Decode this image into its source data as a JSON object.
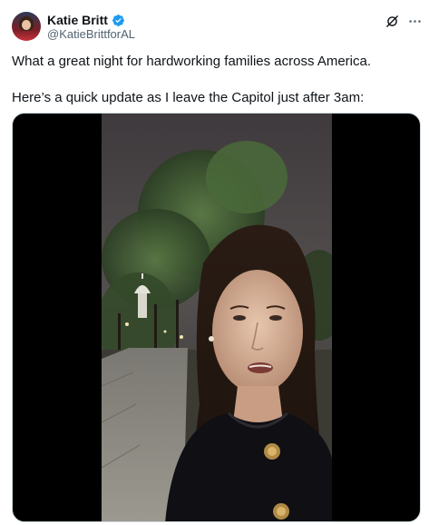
{
  "author": {
    "display_name": "Katie Britt",
    "handle": "@KatieBrittforAL",
    "verified_icon": "verified-badge-icon",
    "verified_color": "#1d9bf0"
  },
  "tweet": {
    "text_line_1": "What a great night for hardworking families across America.",
    "text_line_2": "Here’s a quick update as I leave the Capitol just after 3am:"
  },
  "actions": {
    "grok_icon": "grok-icon",
    "more_icon": "more-icon"
  },
  "media": {
    "type": "video"
  },
  "colors": {
    "text": "#0f1419",
    "secondary": "#536471",
    "media_border": "#cfd9de"
  }
}
